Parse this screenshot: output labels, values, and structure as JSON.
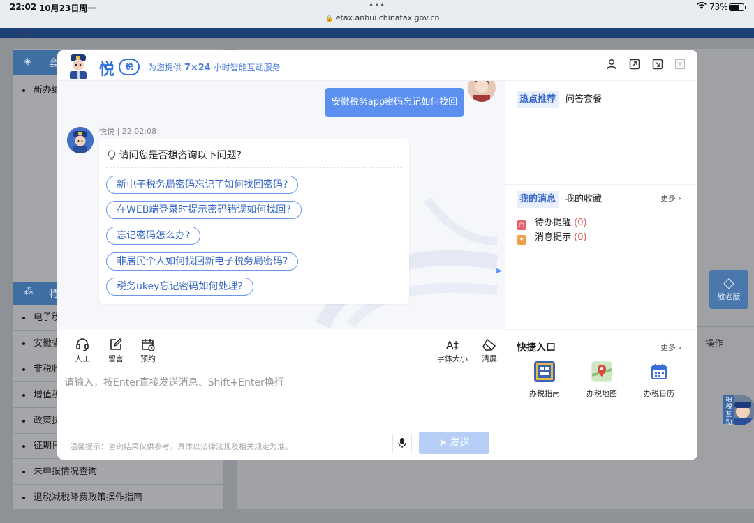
{
  "status_bar": {
    "time": "22:02",
    "date": "10月23日周一",
    "dots": "•••",
    "url": "etax.anhui.chinatax.gov.cn",
    "battery_text": "73%",
    "battery_level": 0.73
  },
  "background": {
    "panel1_title": "套",
    "first_item": "新办纳",
    "panel2_title": "特",
    "items": [
      "电子税",
      "安徽省",
      "非税收",
      "增值税",
      "政策执",
      "征期日",
      "未申报情况查询",
      "退税减税降费政策操作指南"
    ],
    "op_label": "操作",
    "elder_label": "敬老版",
    "float_tag": "纳税互动"
  },
  "dialog": {
    "logo_text": "悦",
    "logo_badge": "税",
    "slogan_prefix": "为您提供 ",
    "slogan_bold": "7×24",
    "slogan_suffix": " 小时智能互动服务",
    "header_icons": [
      "user-icon",
      "expand-icon",
      "export-icon",
      "close-icon"
    ],
    "user_message": "安徽税务app密码忘记如何找回",
    "bot_name_time": "悦悦 | 22:02:08",
    "bot_question": "请问您是否想咨询以下问题?",
    "suggestions": [
      "新电子税务局密码忘记了如何找回密码?",
      "在WEB端登录时提示密码错误如何找回?",
      "忘记密码怎么办?",
      "非居民个人如何找回新电子税务局密码?",
      "税务ukey忘记密码如何处理?"
    ],
    "toolbar": {
      "manual": "人工",
      "message": "留言",
      "appointment": "预约",
      "font_size": "字体大小",
      "clear": "清屏",
      "font_icon": "A‡"
    },
    "input_placeholder": "请输入，按Enter直接发送消息、Shift+Enter换行",
    "tip": "温馨提示：咨询结果仅供参考，具体以法律法规及相关规定为准。",
    "send_label": "发送",
    "right": {
      "tab_hot": "热点推荐",
      "tab_qa": "问答套餐",
      "tab_msg": "我的消息",
      "tab_fav": "我的收藏",
      "more": "更多 ›",
      "todo_label": "待办提醒",
      "todo_count": "(0)",
      "notice_label": "消息提示",
      "notice_count": "(0)",
      "quick_title": "快捷入口",
      "quick_more": "更多 ›",
      "quick_items": [
        "办税指南",
        "办税地图",
        "办税日历"
      ]
    }
  },
  "colors": {
    "accent": "#5b8ff0",
    "send_disabled": "#b7cff7",
    "count_red": "#e05050"
  }
}
